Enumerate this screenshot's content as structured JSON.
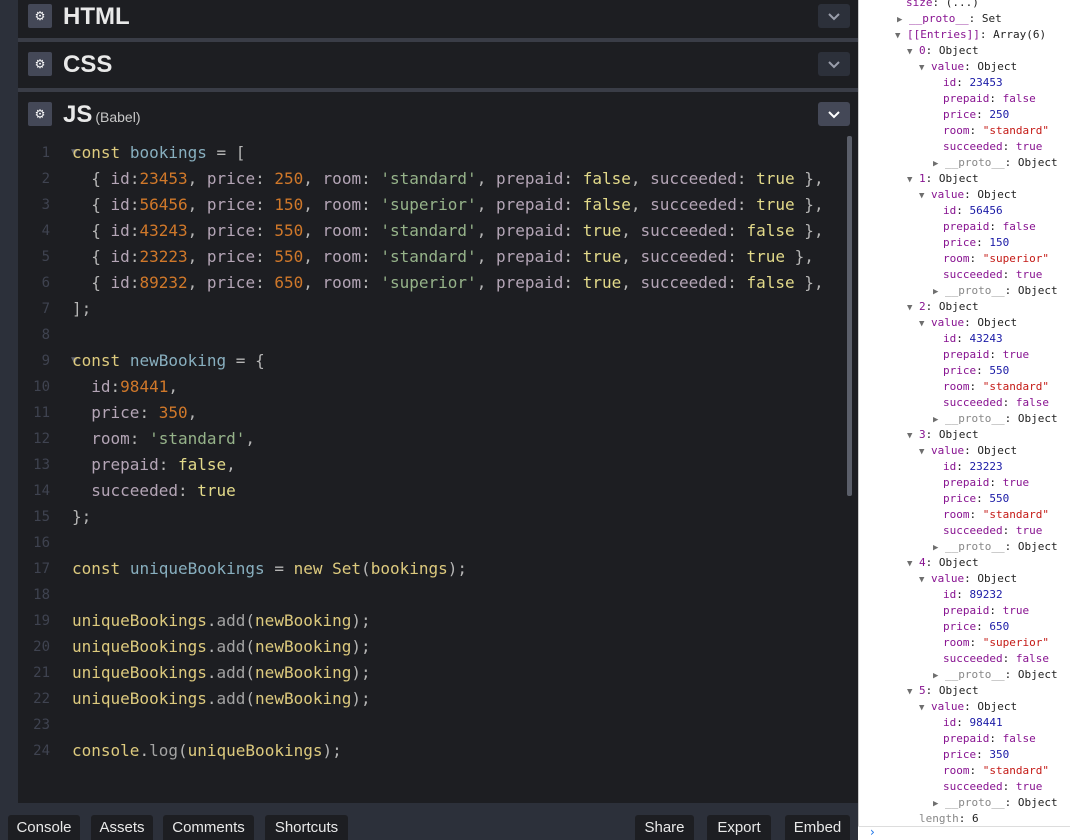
{
  "panels": {
    "html": {
      "title": "HTML"
    },
    "css": {
      "title": "CSS"
    },
    "js": {
      "title": "JS",
      "subtitle": "(Babel)"
    }
  },
  "code_lines": [
    {
      "num": "1",
      "text": "const bookings = ["
    },
    {
      "num": "2",
      "text": "  { id:23453, price: 250, room: 'standard', prepaid: false, succeeded: true },"
    },
    {
      "num": "3",
      "text": "  { id:56456, price: 150, room: 'superior', prepaid: false, succeeded: true },"
    },
    {
      "num": "4",
      "text": "  { id:43243, price: 550, room: 'standard', prepaid: true, succeeded: false },"
    },
    {
      "num": "5",
      "text": "  { id:23223, price: 550, room: 'standard', prepaid: true, succeeded: true },"
    },
    {
      "num": "6",
      "text": "  { id:89232, price: 650, room: 'superior', prepaid: true, succeeded: false },"
    },
    {
      "num": "7",
      "text": "];"
    },
    {
      "num": "8",
      "text": ""
    },
    {
      "num": "9",
      "text": "const newBooking = {"
    },
    {
      "num": "10",
      "text": "  id:98441,"
    },
    {
      "num": "11",
      "text": "  price: 350,"
    },
    {
      "num": "12",
      "text": "  room: 'standard',"
    },
    {
      "num": "13",
      "text": "  prepaid: false,"
    },
    {
      "num": "14",
      "text": "  succeeded: true"
    },
    {
      "num": "15",
      "text": "};"
    },
    {
      "num": "16",
      "text": ""
    },
    {
      "num": "17",
      "text": "const uniqueBookings = new Set(bookings);"
    },
    {
      "num": "18",
      "text": ""
    },
    {
      "num": "19",
      "text": "uniqueBookings.add(newBooking);"
    },
    {
      "num": "20",
      "text": "uniqueBookings.add(newBooking);"
    },
    {
      "num": "21",
      "text": "uniqueBookings.add(newBooking);"
    },
    {
      "num": "22",
      "text": "uniqueBookings.add(newBooking);"
    },
    {
      "num": "23",
      "text": ""
    },
    {
      "num": "24",
      "text": "console.log(uniqueBookings);"
    }
  ],
  "bottom_bar": {
    "console": "Console",
    "assets": "Assets",
    "comments": "Comments",
    "shortcuts": "Shortcuts",
    "share": "Share",
    "export": "Export",
    "embed": "Embed"
  },
  "console_header": {
    "size": "size: (...)",
    "proto": "__proto__: Set",
    "entries": "[[Entries]]: Array(6)"
  },
  "console_entries": [
    {
      "index": "0: Object",
      "id": "23453",
      "prepaid": "false",
      "price": "250",
      "room": "\"standard\"",
      "succeeded": "true"
    },
    {
      "index": "1: Object",
      "id": "56456",
      "prepaid": "false",
      "price": "150",
      "room": "\"superior\"",
      "succeeded": "true"
    },
    {
      "index": "2: Object",
      "id": "43243",
      "prepaid": "true",
      "price": "550",
      "room": "\"standard\"",
      "succeeded": "false"
    },
    {
      "index": "3: Object",
      "id": "23223",
      "prepaid": "true",
      "price": "550",
      "room": "\"standard\"",
      "succeeded": "true"
    },
    {
      "index": "4: Object",
      "id": "89232",
      "prepaid": "true",
      "price": "650",
      "room": "\"superior\"",
      "succeeded": "false"
    },
    {
      "index": "5: Object",
      "id": "98441",
      "prepaid": "false",
      "price": "350",
      "room": "\"standard\"",
      "succeeded": "true"
    }
  ],
  "console_labels": {
    "value": "value: Object",
    "proto": "__proto__: Object"
  },
  "console_length": "length: 6",
  "icons": {
    "gear": "gear-icon",
    "chevron": "chevron-down-icon"
  }
}
